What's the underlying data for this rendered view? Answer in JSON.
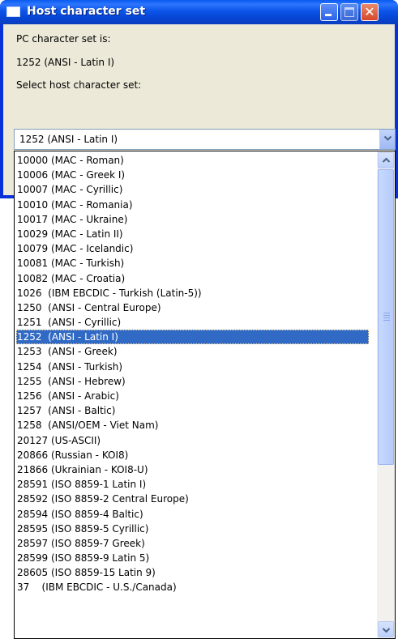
{
  "window": {
    "title": "Host character set"
  },
  "labels": {
    "pc_charset_label": "PC character set is:",
    "pc_charset_value": "1252  (ANSI - Latin I)",
    "select_label": "Select host character set:"
  },
  "combo": {
    "selected": "1252  (ANSI - Latin I)"
  },
  "dropdown": {
    "selected_index": 12,
    "items": [
      "10000 (MAC - Roman)",
      "10006 (MAC - Greek I)",
      "10007 (MAC - Cyrillic)",
      "10010 (MAC - Romania)",
      "10017 (MAC - Ukraine)",
      "10029 (MAC - Latin II)",
      "10079 (MAC - Icelandic)",
      "10081 (MAC - Turkish)",
      "10082 (MAC - Croatia)",
      "1026  (IBM EBCDIC - Turkish (Latin-5))",
      "1250  (ANSI - Central Europe)",
      "1251  (ANSI - Cyrillic)",
      "1252  (ANSI - Latin I)",
      "1253  (ANSI - Greek)",
      "1254  (ANSI - Turkish)",
      "1255  (ANSI - Hebrew)",
      "1256  (ANSI - Arabic)",
      "1257  (ANSI - Baltic)",
      "1258  (ANSI/OEM - Viet Nam)",
      "20127 (US-ASCII)",
      "20866 (Russian - KOI8)",
      "21866 (Ukrainian - KOI8-U)",
      "28591 (ISO 8859-1 Latin I)",
      "28592 (ISO 8859-2 Central Europe)",
      "28594 (ISO 8859-4 Baltic)",
      "28595 (ISO 8859-5 Cyrillic)",
      "28597 (ISO 8859-7 Greek)",
      "28599 (ISO 8859-9 Latin 5)",
      "28605 (ISO 8859-15 Latin 9)",
      "37    (IBM EBCDIC - U.S./Canada)"
    ]
  },
  "icons": {
    "app": "window-icon",
    "minimize": "minimize-icon",
    "maximize": "maximize-icon",
    "close": "close-icon",
    "combo_arrow": "chevron-down-icon",
    "scroll_up": "chevron-up-icon",
    "scroll_down": "chevron-down-icon"
  },
  "colors": {
    "selection": "#316ac5",
    "titlebar": "#0a5bf0",
    "dialog_bg": "#ece9d8"
  }
}
